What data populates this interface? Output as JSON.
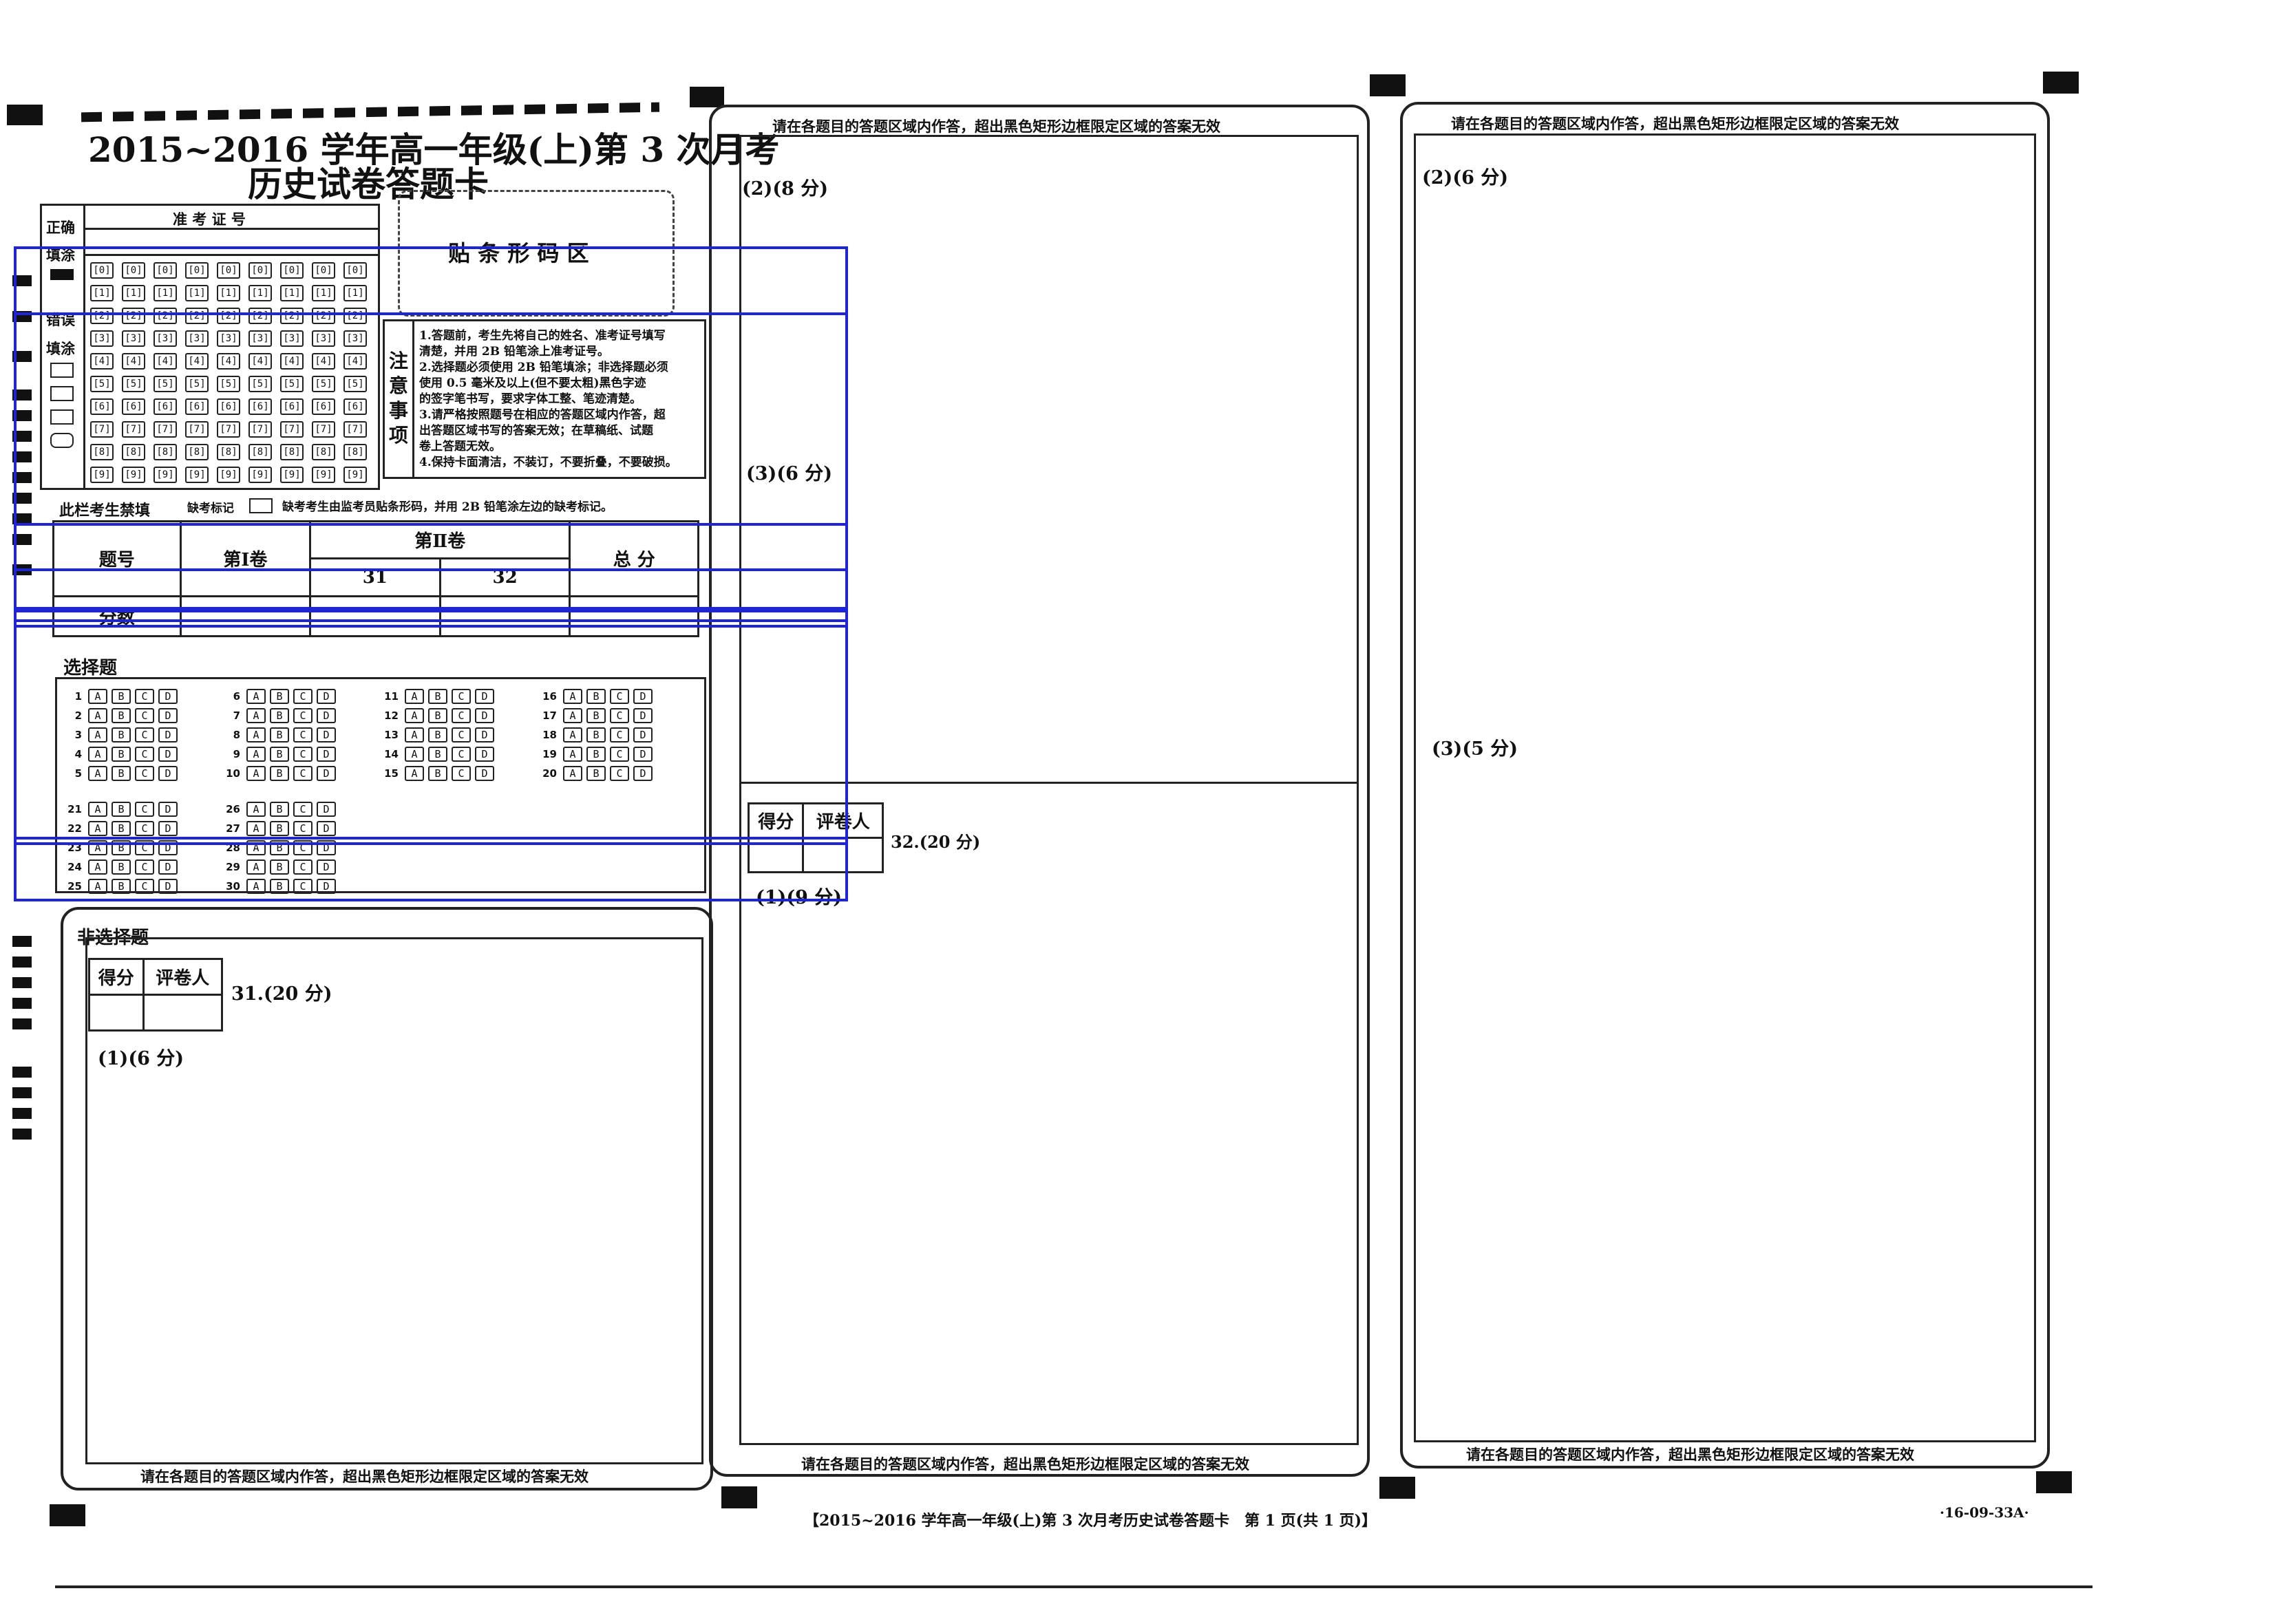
{
  "header": {
    "title_line1": "2015~2016 学年高一年级(上)第 3 次月考",
    "title_line2": "历史试卷答题卡"
  },
  "id_section": {
    "correct_label_1": "正确",
    "correct_label_2": "填涂",
    "id_label": "准 考 证 号",
    "wrong_label_1": "错误",
    "wrong_label_2": "填涂",
    "digits": [
      "0",
      "1",
      "2",
      "3",
      "4",
      "5",
      "6",
      "7",
      "8",
      "9"
    ]
  },
  "barcode": {
    "label": "贴 条 形 码 区"
  },
  "notice": {
    "heading": "注意事项",
    "lines": [
      "1.答题前，考生先将自己的姓名、准考证号填写",
      "清楚，并用 2B 铅笔涂上准考证号。",
      "2.选择题必须使用 2B 铅笔填涂；非选择题必须",
      "使用 0.5 毫米及以上(但不要太粗)黑色字迹",
      "的签字笔书写，要求字体工整、笔迹清楚。",
      "3.请严格按照题号在相应的答题区域内作答，超",
      "出答题区域书写的答案无效；在草稿纸、试题",
      "卷上答题无效。",
      "4.保持卡面清洁，不装订，不要折叠，不要破损。"
    ]
  },
  "absent": {
    "label": "此栏考生禁填",
    "mark_label": "缺考标记",
    "instruction": "缺考考生由监考员贴条形码，并用 2B 铅笔涂左边的缺考标记。"
  },
  "score_table": {
    "row1_label": "题号",
    "row2_label": "分数",
    "part1": "第Ⅰ卷",
    "part2": "第Ⅱ卷",
    "col_31": "31",
    "col_32": "32",
    "total": "总 分"
  },
  "choice": {
    "heading": "选择题",
    "options": [
      "A",
      "B",
      "C",
      "D"
    ],
    "numbers": [
      "1",
      "2",
      "3",
      "4",
      "5",
      "6",
      "7",
      "8",
      "9",
      "10",
      "11",
      "12",
      "13",
      "14",
      "15",
      "16",
      "17",
      "18",
      "19",
      "20",
      "21",
      "22",
      "23",
      "24",
      "25",
      "26",
      "27",
      "28",
      "29",
      "30"
    ]
  },
  "nonchoice": {
    "heading": "非选择题",
    "score_label": "得分",
    "grader_label": "评卷人",
    "q31": "31.(20 分)",
    "q31_1": "(1)(6 分)"
  },
  "col2": {
    "top_note": "请在各题目的答题区域内作答，超出黑色矩形边框限定区域的答案无效",
    "q31_2": "(2)(8 分)",
    "q31_3": "(3)(6 分)",
    "score_label": "得分",
    "grader_label": "评卷人",
    "q32": "32.(20 分)",
    "q32_1": "(1)(9 分)"
  },
  "col3": {
    "top_note": "请在各题目的答题区域内作答，超出黑色矩形边框限定区域的答案无效",
    "q32_2": "(2)(6 分)",
    "q32_3": "(3)(5 分)"
  },
  "bottom_notes": {
    "col1": "请在各题目的答题区域内作答，超出黑色矩形边框限定区域的答案无效",
    "col2": "请在各题目的答题区域内作答，超出黑色矩形边框限定区域的答案无效",
    "col3": "请在各题目的答题区域内作答，超出黑色矩形边框限定区域的答案无效"
  },
  "footer": {
    "page_label": "【2015~2016 学年高一年级(上)第 3 次月考历史试卷答题卡　第 1 页(共 1 页)】",
    "code": "·16-09-33A·"
  },
  "colors": {
    "ink": "#111111",
    "overlay_blue": "#1e24d8"
  }
}
